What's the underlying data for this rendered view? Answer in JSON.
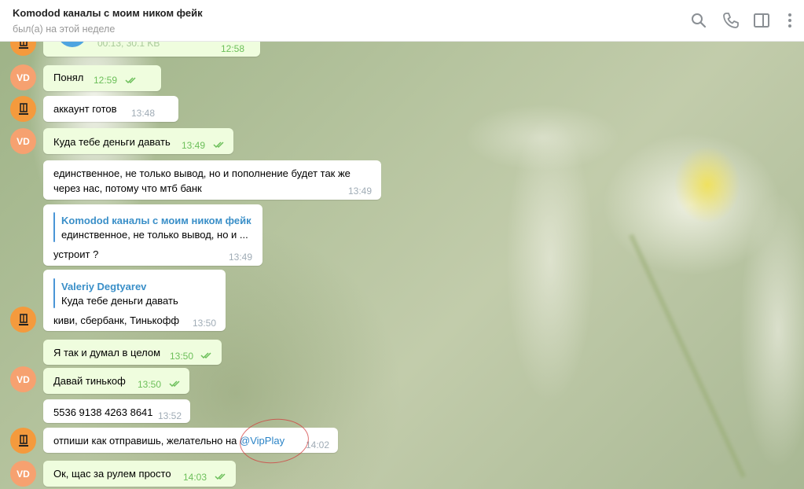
{
  "header": {
    "title": "Komodod каналы с моим ником фейк",
    "subtitle": "был(а) на этой неделе",
    "icons": [
      "search-icon",
      "phone-icon",
      "sidebar-toggle-icon",
      "more-icon"
    ]
  },
  "colors": {
    "outgoing_bubble": "#effdde",
    "incoming_bubble": "#ffffff",
    "time_out": "#6cbf5a",
    "link": "#2a83c6",
    "avatar_vd": "#f6a170",
    "avatar_logo": "#f49a3d"
  },
  "avatars": {
    "vd_initials": "VD"
  },
  "messages": [
    {
      "id": "m0",
      "dir": "out",
      "file_meta": "00:13, 30.1 KB",
      "time": "12:58"
    },
    {
      "id": "m1",
      "dir": "out",
      "text": "Понял",
      "time": "12:59"
    },
    {
      "id": "m2",
      "dir": "in",
      "text": "аккаунт готов",
      "time": "13:48"
    },
    {
      "id": "m3",
      "dir": "out",
      "text": "Куда тебе деньги давать",
      "time": "13:49"
    },
    {
      "id": "m4",
      "dir": "in",
      "line1": "единственное, не только вывод, но и пополнение будет так же",
      "line2": "через нас, потому что мтб банк",
      "time": "13:49"
    },
    {
      "id": "m5",
      "dir": "in",
      "quote_name": "Komodod каналы с моим ником фейк",
      "quote_text": "единственное, не только вывод, но и ...",
      "text": "устроит ?",
      "time": "13:49"
    },
    {
      "id": "m6",
      "dir": "in",
      "quote_name": "Valeriy Degtyarev",
      "quote_text": "Куда тебе деньги давать",
      "text": "киви, сбербанк, Тинькофф",
      "time": "13:50"
    },
    {
      "id": "m7",
      "dir": "out",
      "text": "Я так и думал в целом",
      "time": "13:50"
    },
    {
      "id": "m8",
      "dir": "out",
      "text": "Давай тинькоф",
      "time": "13:50"
    },
    {
      "id": "m9",
      "dir": "in",
      "text": "5536 9138 4263 8641",
      "time": "13:52"
    },
    {
      "id": "m10",
      "dir": "in",
      "text": "отпиши как отправишь, желательно на ",
      "mention": "@VipPlay",
      "time": "14:02"
    },
    {
      "id": "m11",
      "dir": "out",
      "text": "Ок, щас за рулем просто",
      "time": "14:03"
    }
  ]
}
